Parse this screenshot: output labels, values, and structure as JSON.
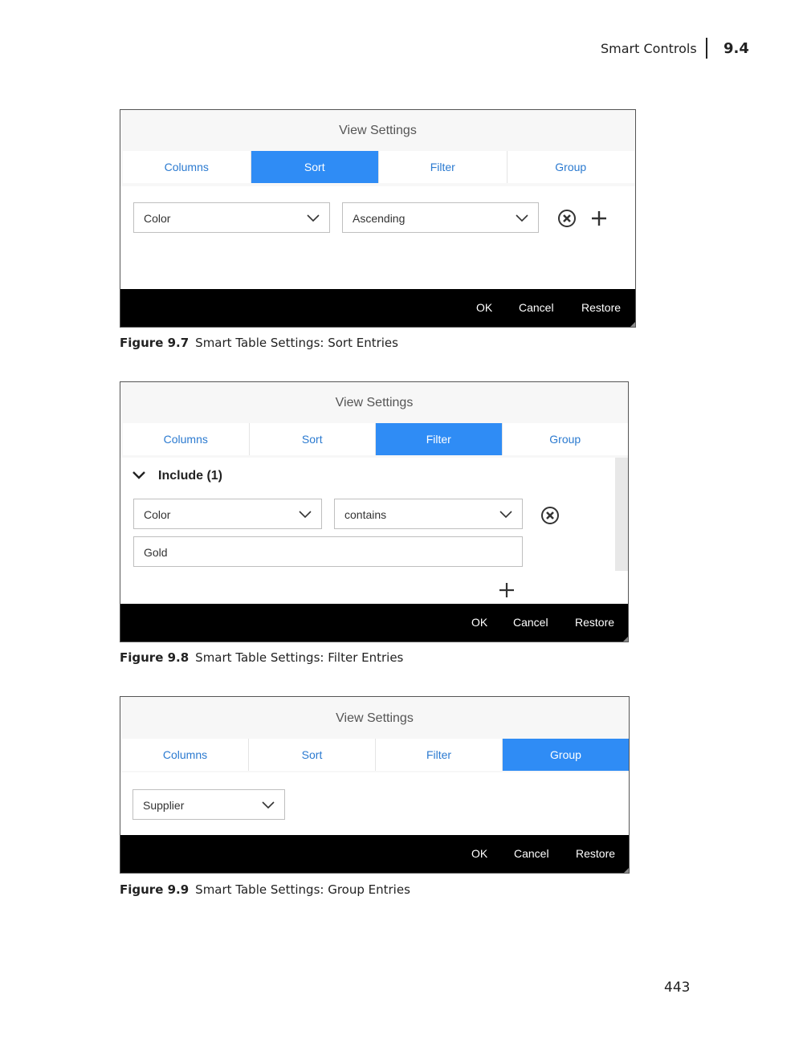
{
  "header": {
    "section_title": "Smart Controls",
    "section_number": "9.4"
  },
  "page_number": "443",
  "common": {
    "dialog_title": "View Settings",
    "tabs": [
      "Columns",
      "Sort",
      "Filter",
      "Group"
    ],
    "footer": {
      "ok": "OK",
      "cancel": "Cancel",
      "restore": "Restore"
    }
  },
  "figures": [
    {
      "label": "Figure 9.7",
      "caption": "Smart Table Settings: Sort Entries",
      "active_tab": "Sort",
      "sort_field": "Color",
      "sort_order": "Ascending"
    },
    {
      "label": "Figure 9.8",
      "caption": "Smart Table Settings: Filter Entries",
      "active_tab": "Filter",
      "include_label": "Include (1)",
      "filter_field": "Color",
      "filter_operator": "contains",
      "filter_value": "Gold"
    },
    {
      "label": "Figure 9.9",
      "caption": "Smart Table Settings: Group Entries",
      "active_tab": "Group",
      "group_field": "Supplier"
    }
  ],
  "colors": {
    "accent": "#2f8cf5",
    "tab_text": "#2b7ad0",
    "footer_bg": "#000000"
  },
  "icons": [
    "remove-circle-icon",
    "add-icon",
    "chevron-down-icon",
    "collapse-chevron-icon"
  ]
}
